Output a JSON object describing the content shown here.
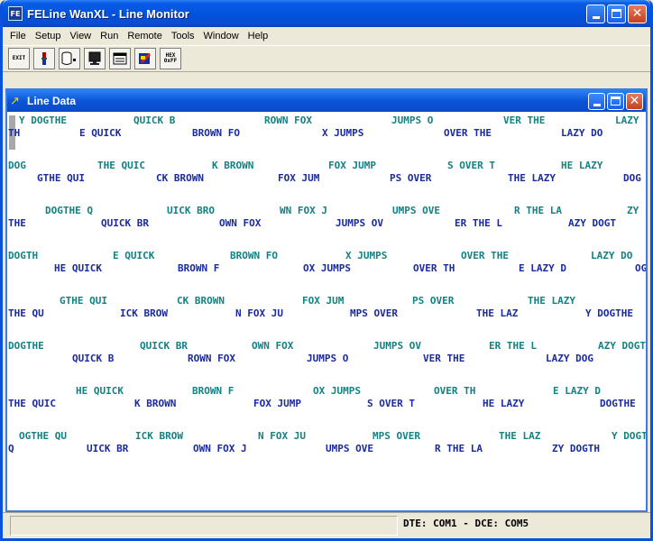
{
  "window": {
    "title": "FELine WanXL - Line Monitor",
    "app_icon": "FE",
    "icon": "feline-app-icon"
  },
  "menu": [
    "File",
    "Setup",
    "View",
    "Run",
    "Remote",
    "Tools",
    "Window",
    "Help"
  ],
  "toolbar": [
    {
      "name": "exit-button",
      "icon": "exit-icon",
      "label": "EXIT"
    },
    {
      "name": "trace-button",
      "icon": "trace-icon",
      "label": ""
    },
    {
      "name": "database-button",
      "icon": "database-icon",
      "label": ""
    },
    {
      "name": "monitor-button",
      "icon": "monitor-icon",
      "label": ""
    },
    {
      "name": "display-button",
      "icon": "display-icon",
      "label": ""
    },
    {
      "name": "filter-button",
      "icon": "filter-icon",
      "label": ""
    },
    {
      "name": "hex-button",
      "icon": "hex-icon",
      "label": "HEX 0xFF"
    }
  ],
  "child": {
    "title": "Line Data",
    "icon": "line-data-icon"
  },
  "colors": {
    "dte_text": "#128282",
    "dce_text": "#1a2aa0"
  },
  "status": {
    "text": "DTE: COM1 - DCE: COM5"
  },
  "lines": [
    {
      "kind": "dte",
      "segs": [
        "Y DOGTHE",
        "QUICK B",
        "ROWN FOX",
        "JUMPS O",
        "VER THE",
        "LAZY"
      ]
    },
    {
      "kind": "dce",
      "segs": [
        "TH",
        "E QUICK",
        "BROWN FO",
        "X JUMPS",
        "OVER THE",
        "LAZY DO"
      ]
    },
    {
      "kind": "dte",
      "segs": [
        "DOG",
        "THE QUIC",
        "K BROWN",
        "FOX JUMP",
        "S OVER T",
        "HE LAZY"
      ]
    },
    {
      "kind": "dce",
      "segs": [
        "GTHE QUI",
        "CK BROWN",
        "FOX JUM",
        "PS OVER",
        "THE LAZY",
        "DOG"
      ]
    },
    {
      "kind": "dte",
      "segs": [
        "DOGTHE Q",
        "UICK BRO",
        "WN FOX J",
        "UMPS OVE",
        "R THE LA",
        "ZY"
      ]
    },
    {
      "kind": "dce",
      "segs": [
        "THE",
        "QUICK BR",
        "OWN FOX",
        "JUMPS OV",
        "ER THE L",
        "AZY DOGT"
      ]
    },
    {
      "kind": "dte",
      "segs": [
        "DOGTH",
        "E QUICK",
        "BROWN FO",
        "X JUMPS",
        "OVER THE",
        "LAZY DO"
      ]
    },
    {
      "kind": "dce",
      "segs": [
        "HE QUICK",
        "BROWN F",
        "OX JUMPS",
        "OVER TH",
        "E LAZY D",
        "OG"
      ]
    },
    {
      "kind": "dte",
      "segs": [
        "GTHE QUI",
        "CK BROWN",
        "FOX JUM",
        "PS OVER",
        "THE LAZY",
        ""
      ]
    },
    {
      "kind": "dce",
      "segs": [
        "THE QU",
        "ICK BROW",
        "N FOX JU",
        "MPS OVER",
        "THE LAZ",
        "Y DOGTHE"
      ]
    },
    {
      "kind": "dte",
      "segs": [
        "DOGTHE",
        "QUICK BR",
        "OWN FOX",
        "JUMPS OV",
        "ER THE L",
        "AZY DOGT"
      ]
    },
    {
      "kind": "dce",
      "segs": [
        "QUICK B",
        "ROWN FOX",
        "JUMPS O",
        "VER THE",
        "LAZY DOG",
        ""
      ]
    },
    {
      "kind": "dte",
      "segs": [
        "HE QUICK",
        "BROWN F",
        "OX JUMPS",
        "OVER TH",
        "E LAZY D",
        ""
      ]
    },
    {
      "kind": "dce",
      "segs": [
        "THE QUIC",
        "K BROWN",
        "FOX JUMP",
        "S OVER T",
        "HE LAZY",
        "DOGTHE"
      ]
    },
    {
      "kind": "dte",
      "segs": [
        "OGTHE QU",
        "ICK BROW",
        "N FOX JU",
        "MPS OVER",
        "THE LAZ",
        "Y DOGT"
      ]
    },
    {
      "kind": "dce",
      "segs": [
        "Q",
        "UICK BR",
        "OWN FOX J",
        "UMPS OVE",
        "R THE LA",
        "ZY DOGTH"
      ]
    }
  ]
}
